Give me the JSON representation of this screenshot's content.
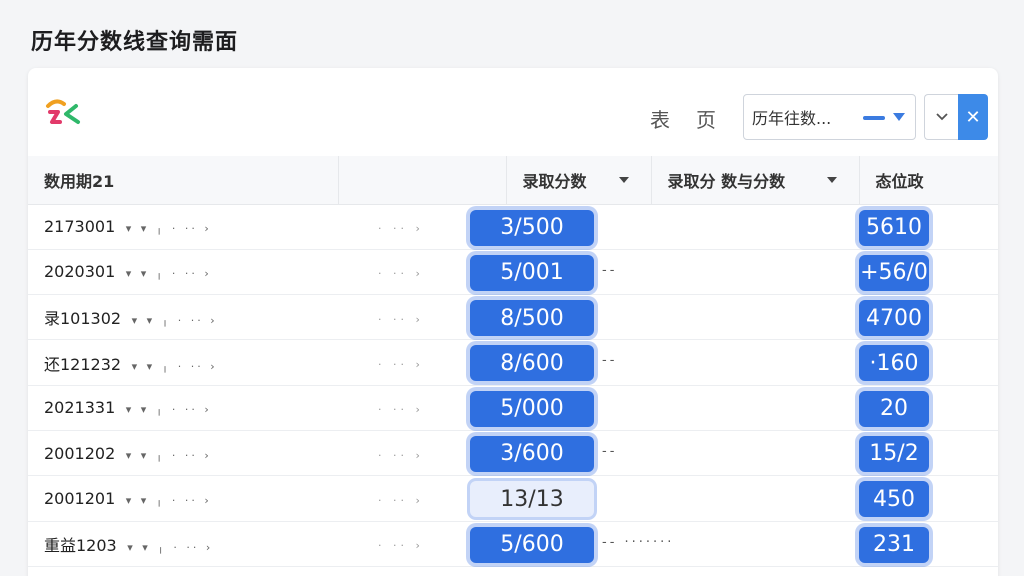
{
  "page_title": "历年分数线查询需面",
  "toolbar": {
    "label_1": "表",
    "label_2": "页",
    "select_value": "历年往数...",
    "expand_icon": "chevron-down-icon",
    "close_label": "✕",
    "accent": "#3d8ae8"
  },
  "table": {
    "headers": [
      "数用期21",
      "",
      "录取分数",
      "录取分 数与分数",
      "态位政"
    ],
    "rows": [
      {
        "id": "2173001",
        "score": "3/500",
        "dash": "",
        "pos": "5610"
      },
      {
        "id": "2020301",
        "score": "5/001",
        "dash": "--",
        "pos": "+56/0"
      },
      {
        "id": "录101302",
        "score": "8/500",
        "dash": "",
        "pos": "4700"
      },
      {
        "id": "还121232",
        "score": "8/600",
        "dash": "--",
        "pos": "·160"
      },
      {
        "id": "2021331",
        "score": "5/000",
        "dash": "",
        "pos": "20"
      },
      {
        "id": "2001202",
        "score": "3/600",
        "dash": "--",
        "pos": "15/2"
      },
      {
        "id": "2001201",
        "score": "13/13",
        "dash": "",
        "pos": "450"
      },
      {
        "id": "重益1203",
        "score": "5/600",
        "dash": "-- ·······",
        "pos": "231"
      }
    ]
  }
}
